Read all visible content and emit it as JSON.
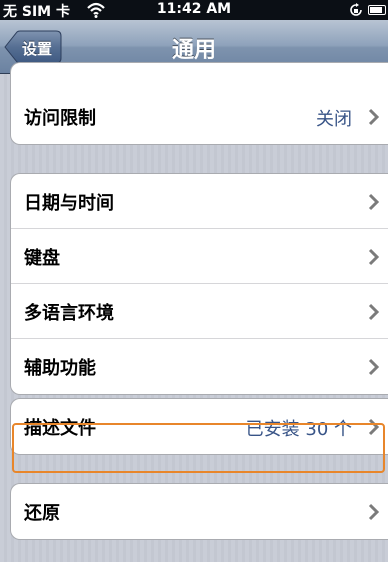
{
  "status_bar": {
    "carrier": "无 SIM 卡",
    "time": "11:42 AM"
  },
  "nav": {
    "back_label": "设置",
    "title": "通用"
  },
  "groups": [
    [
      {
        "label": "访问限制",
        "value": "关闭"
      }
    ],
    [
      {
        "label": "日期与时间"
      },
      {
        "label": "键盘"
      },
      {
        "label": "多语言环境"
      },
      {
        "label": "辅助功能"
      }
    ],
    [
      {
        "label": "描述文件",
        "value": "已安装 30 个",
        "highlighted": true
      }
    ],
    [
      {
        "label": "还原"
      }
    ]
  ],
  "colors": {
    "value_text": "#385487",
    "highlight_border": "#e8862b"
  }
}
